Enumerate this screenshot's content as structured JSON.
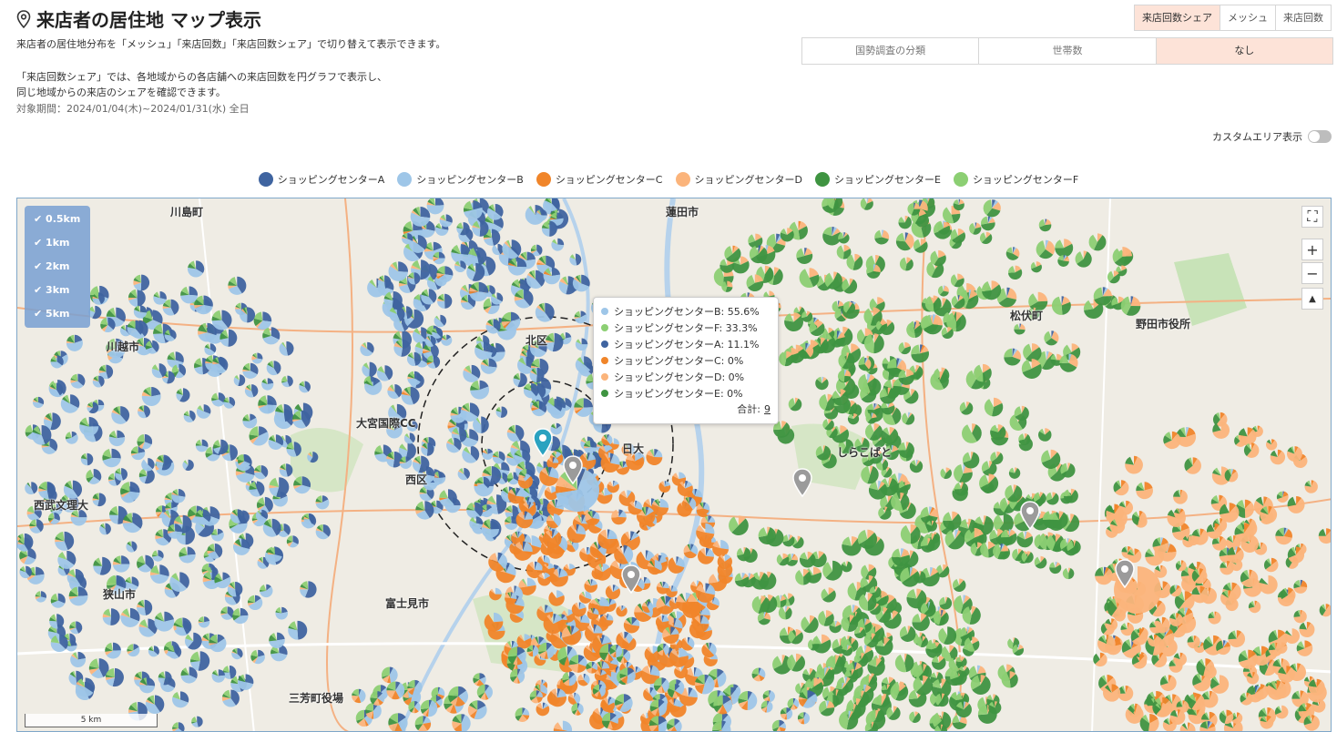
{
  "header": {
    "title": "来店者の居住地 マップ表示",
    "description1": "来店者の居住地分布を「メッシュ」「来店回数」「来店回数シェア」で切り替えて表示できます。",
    "description2": "「来店回数シェア」では、各地域からの各店舗への来店回数を円グラフで表示し、",
    "description3": "同じ地域からの来店のシェアを確認できます。",
    "period": "対象期間：2024/01/04(木)~2024/01/31(水) 全日"
  },
  "mode_tabs": [
    {
      "label": "来店回数シェア",
      "active": true
    },
    {
      "label": "メッシュ",
      "active": false
    },
    {
      "label": "来店回数",
      "active": false
    }
  ],
  "category_tabs": [
    {
      "label": "国勢調査の分類",
      "active": false
    },
    {
      "label": "世帯数",
      "active": false
    },
    {
      "label": "なし",
      "active": true
    }
  ],
  "custom_area": {
    "label": "カスタムエリア表示",
    "on": false
  },
  "legend": [
    {
      "label": "ショッピングセンターA",
      "color": "#3f64a0"
    },
    {
      "label": "ショッピングセンターB",
      "color": "#9ec6e8"
    },
    {
      "label": "ショッピングセンターC",
      "color": "#f0852a"
    },
    {
      "label": "ショッピングセンターD",
      "color": "#fbb47b"
    },
    {
      "label": "ショッピングセンターE",
      "color": "#3f9441"
    },
    {
      "label": "ショッピングセンターF",
      "color": "#8ccf73"
    }
  ],
  "radius_filters": [
    "✔ 0.5km",
    "✔ 1km",
    "✔ 2km",
    "✔ 3km",
    "✔ 5km"
  ],
  "map": {
    "labels": [
      "川島町",
      "蓮田市",
      "川越市",
      "松伏町",
      "北区",
      "西区",
      "富士見市",
      "狭山市",
      "野田市役所",
      "西武文理大",
      "しらこばと",
      "三芳町役場",
      "日大",
      "大宮国際CC"
    ],
    "controls": {
      "fullscreen": "⛶",
      "zoom_in": "+",
      "zoom_out": "−",
      "compass": "▲"
    },
    "scale": "5 km"
  },
  "tooltip": {
    "rows": [
      {
        "label": "ショッピングセンターB: 55.6%",
        "color": "#9ec6e8"
      },
      {
        "label": "ショッピングセンターF: 33.3%",
        "color": "#8ccf73"
      },
      {
        "label": "ショッピングセンターA: 11.1%",
        "color": "#3f64a0"
      },
      {
        "label": "ショッピングセンターC: 0%",
        "color": "#f0852a"
      },
      {
        "label": "ショッピングセンターD: 0%",
        "color": "#fbb47b"
      },
      {
        "label": "ショッピングセンターE: 0%",
        "color": "#3f9441"
      }
    ],
    "total_label": "合計:",
    "total_value": "9"
  }
}
